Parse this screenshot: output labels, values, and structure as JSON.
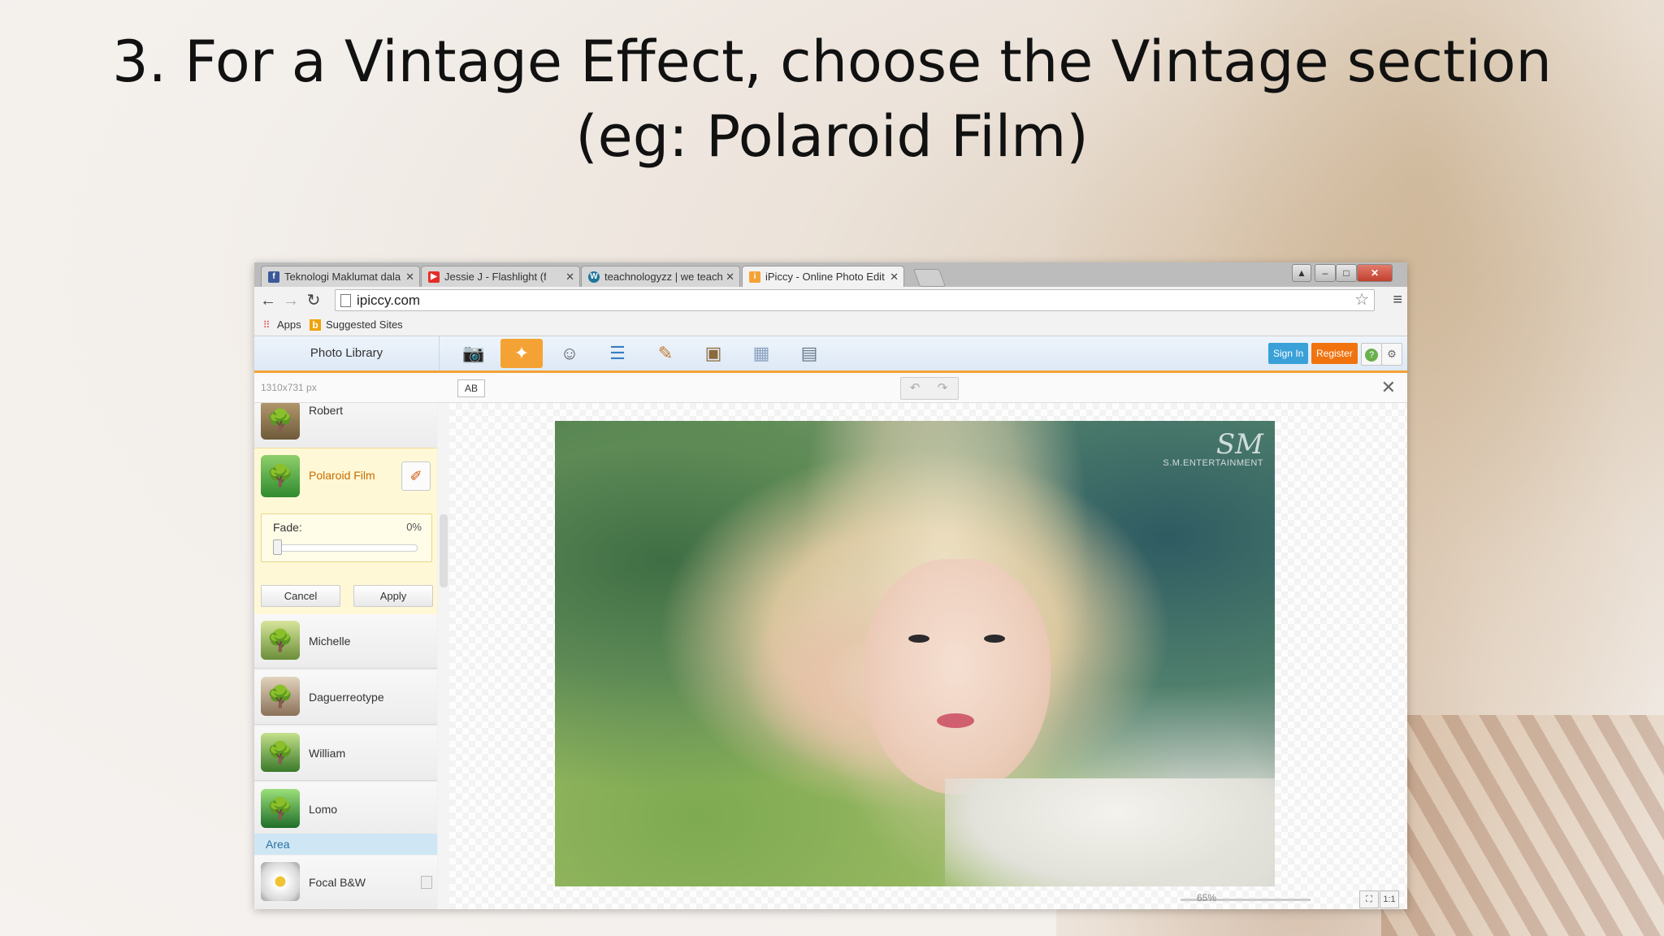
{
  "slide": {
    "title_line1": "3. For a Vintage Effect, choose the Vintage section",
    "title_line2": "(eg: Polaroid Film)"
  },
  "browser": {
    "tabs": [
      {
        "label": "Teknologi Maklumat dala",
        "icon": "facebook-icon",
        "color": "#3b5998"
      },
      {
        "label": "Jessie J - Flashlight (fro",
        "icon": "youtube-icon",
        "color": "#e52d27"
      },
      {
        "label": "teachnologyzz | we teach",
        "icon": "wordpress-icon",
        "color": "#21759b"
      },
      {
        "label": "iPiccy - Online Photo Edit",
        "icon": "ipiccy-icon",
        "color": "#f5a235"
      }
    ],
    "url": "ipiccy.com",
    "bookmarks": [
      {
        "label": "Apps",
        "icon": "apps-grid-icon"
      },
      {
        "label": "Suggested Sites",
        "icon": "bing-icon"
      }
    ]
  },
  "app": {
    "photo_library": "Photo Library",
    "sign_in": "Sign In",
    "register": "Register",
    "image_size": "1310x731 px",
    "compare_toggle": "AB",
    "tools": [
      "camera-icon",
      "magic-wand-icon",
      "face-icon",
      "layers-icon",
      "paint-icon",
      "frame-icon",
      "texture-icon",
      "save-icon"
    ],
    "accent_color": "#f5a235",
    "sign_in_color": "#3aa0d8",
    "register_color": "#f0730f"
  },
  "effects": {
    "top_partial": "Robert",
    "selected": {
      "label": "Polaroid Film",
      "fade_label": "Fade:",
      "fade_value": "0%",
      "fade_fraction": 0,
      "cancel": "Cancel",
      "apply": "Apply"
    },
    "items": [
      "Michelle",
      "Daguerreotype",
      "William",
      "Lomo"
    ],
    "section": "Area",
    "area_items": [
      "Focal B&W"
    ]
  },
  "canvas": {
    "watermark_logo": "SM",
    "watermark_text": "S.M.ENTERTAINMENT",
    "zoom": "65%",
    "fit_label": "1:1"
  }
}
